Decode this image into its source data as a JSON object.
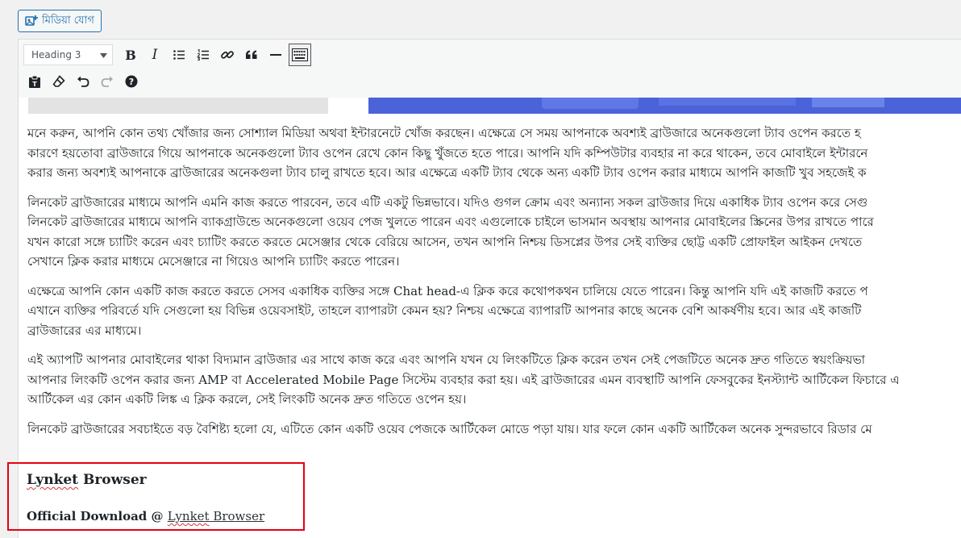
{
  "media_button": {
    "label": "মিডিয়া যোগ",
    "icon": "add-media-icon"
  },
  "toolbar": {
    "format_select": {
      "selected": "Heading 3"
    },
    "row1": [
      {
        "name": "bold-icon",
        "glyph": "B"
      },
      {
        "name": "italic-icon",
        "glyph": "I"
      },
      {
        "name": "bulleted-list-icon"
      },
      {
        "name": "numbered-list-icon"
      },
      {
        "name": "link-icon"
      },
      {
        "name": "blockquote-icon"
      },
      {
        "name": "horizontal-line-icon"
      },
      {
        "name": "toolbar-toggle-icon"
      }
    ],
    "row2": [
      {
        "name": "paste-as-text-icon"
      },
      {
        "name": "clear-formatting-icon"
      },
      {
        "name": "undo-icon"
      },
      {
        "name": "redo-icon"
      },
      {
        "name": "help-icon"
      }
    ]
  },
  "content": {
    "paragraphs": [
      [
        "মনে করুন, আপনি কোন তথ্য খোঁজার জন্য সোশ্যাল মিডিয়া অথবা ইন্টারনেটে খোঁজ করছেন। এক্ষেত্রে সে সময় আপনাকে অবশ্যই ব্রাউজারে অনেকগুলো ট্যাব ওপেন করতে হ",
        "কারণে হয়তোবা ব্রাউজারে গিয়ে আপনাকে অনেকগুলো ট্যাব ওপেন রেখে কোন কিছু খুঁজতে হতে পারে। আপনি যদি কম্পিউটার ব্যবহার না করে থাকেন, তবে মোবাইলে ইন্টারনে",
        "করার জন্য অবশ্যই আপনাকে ব্রাউজারের অনেকগুলা ট্যাব চালু রাখতে হবে। আর এক্ষেত্রে একটি ট্যাব থেকে অন্য একটি ট্যাব ওপেন করার মাধ্যমে আপনি কাজটি খুব সহজেই ক"
      ],
      [
        "লিনকেট ব্রাউজারের মাধ্যমে আপনি এমনি কাজ করতে পারবেন, তবে এটি একটু ভিন্নভাবে। যদিও গুগল ক্রোম এবং অন্যান্য সকল ব্রাউজার দিয়ে একাধিক ট্যাব ওপেন করে সেগু",
        "লিনকেট ব্রাউজারের মাধ্যমে আপনি ব্যাকগ্রাউন্ডে অনেকগুলো ওয়েব পেজ খুলতে পারেন এবং এগুলোকে চাইলে ভাসমান অবস্থায় আপনার মোবাইলের স্ক্রিনের উপর রাখতে পারে",
        "যখন কারো সঙ্গে চ্যাটিং করেন এবং চ্যাটিং করতে করতে মেসেঞ্জার থেকে বেরিয়ে আসেন, তখন আপনি নিশ্চয় ডিসপ্লের উপর সেই ব্যক্তির ছোট্ট একটি প্রোফাইল আইকন দেখতে",
        "সেখানে ক্লিক করার মাধ্যমে মেসেঞ্জারে না গিয়েও আপনি চ্যাটিং করতে পারেন।"
      ],
      [
        "এক্ষেত্রে আপনি কোন একটি কাজ করতে করতে সেসব একাধিক ব্যক্তির সঙ্গে Chat head-এ ক্লিক করে কথোপকথন চালিয়ে যেতে পারেন। কিন্তু আপনি যদি এই কাজটি করতে প",
        "এখানে ব্যক্তির পরিবর্তে যদি সেগুলো হয় বিভিন্ন ওয়েবসাইট, তাহলে ব্যাপারটা কেমন হয়? নিশ্চয় এক্ষেত্রে ব্যাপারটি আপনার কাছে অনেক বেশি আকর্ষণীয় হবে। আর এই কাজটি",
        "ব্রাউজারের এর মাধ্যমে।"
      ],
      [
        "এই অ্যাপটি আপনার মোবাইলের থাকা বিদ্যমান ব্রাউজার এর সাথে কাজ করে এবং আপনি যখন যে লিংকটিতে ক্লিক করেন তখন সেই পেজটিতে অনেক দ্রুত গতিতে স্বয়ংক্রিয়ভা",
        "আপনার লিংকটি ওপেন করার জন্য AMP বা Accelerated Mobile Page সিস্টেম ব্যবহার করা হয়। এই ব্রাউজারের এমন ব্যবস্থাটি আপনি ফেসবুকের ইনস্ট্যান্ট আর্টিকেল ফিচারে এ",
        "আর্টিকেল এর কোন একটি লিঙ্ক এ ক্লিক করলে, সেই লিংকটি অনেক দ্রুত গতিতে ওপেন হয়।"
      ],
      [
        "লিনকেট ব্রাউজারের সবচাইতে বড় বৈশিষ্ট্য হলো যে, এটিতে কোন একটি ওয়েব পেজকে আর্টিকেল মোডে পড়া যায়। যার ফলে কোন একটি আর্টিকেল অনেক সুন্দরভাবে রিডার মে"
      ]
    ],
    "heading": {
      "word1": "Lynket",
      "word2": " Browser"
    },
    "download": {
      "prefix": "Official Download @ ",
      "link_word1": "Lynket",
      "link_word2": " Browser"
    }
  },
  "colors": {
    "accent": "#2271b1",
    "highlight_box": "#e5000f",
    "spellcheck": "#d63638"
  }
}
